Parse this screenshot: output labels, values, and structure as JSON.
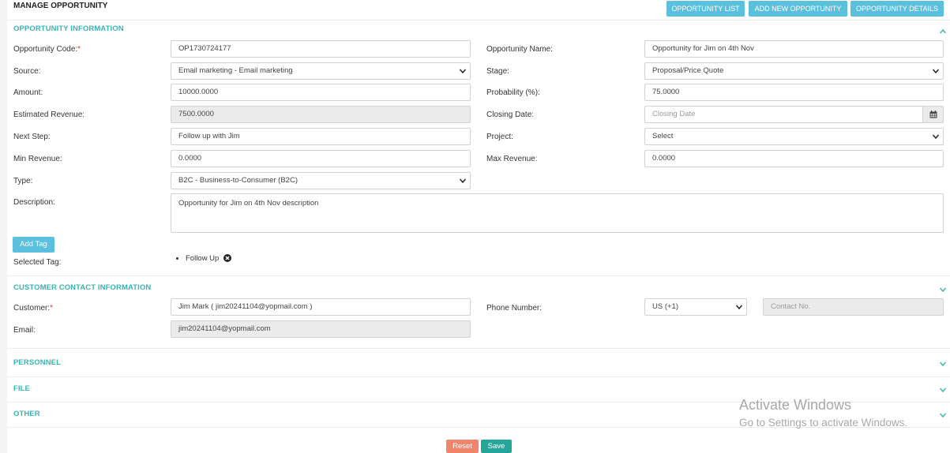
{
  "header": {
    "title": "MANAGE OPPORTUNITY",
    "buttons": {
      "list": "OPPORTUNITY LIST",
      "add_new": "ADD NEW OPPORTUNITY",
      "details": "OPPORTUNITY DETAILS"
    }
  },
  "opportunity_info": {
    "title": "OPPORTUNITY INFORMATION",
    "chevron": "chevron-up-icon",
    "fields": {
      "code": {
        "label": "Opportunity Code:",
        "required": "*",
        "value": "OP1730724177"
      },
      "name": {
        "label": "Opportunity Name:",
        "value": "Opportunity for Jim on 4th Nov"
      },
      "source": {
        "label": "Source:",
        "value": "Email marketing - Email marketing"
      },
      "stage": {
        "label": "Stage:",
        "value": "Proposal/Price Quote"
      },
      "amount": {
        "label": "Amount:",
        "value": "10000.0000"
      },
      "probability": {
        "label": "Probability (%):",
        "value": "75.0000"
      },
      "estimated_revenue": {
        "label": "Estimated Revenue:",
        "value": "7500.0000"
      },
      "closing_date": {
        "label": "Closing Date:",
        "value": "",
        "placeholder": "Closing Date"
      },
      "next_step": {
        "label": "Next Step:",
        "value": "Follow up with Jim"
      },
      "project": {
        "label": "Project:",
        "value": "Select"
      },
      "min_revenue": {
        "label": "Min Revenue:",
        "value": "0.0000"
      },
      "max_revenue": {
        "label": "Max Revenue:",
        "value": "0.0000"
      },
      "type": {
        "label": "Type:",
        "value": "B2C - Business-to-Consumer (B2C)"
      },
      "description": {
        "label": "Description:",
        "value": "Opportunity for Jim on 4th Nov description"
      }
    },
    "add_tag_label": "Add Tag",
    "selected_tag_label": "Selected Tag:",
    "tags": [
      "Follow Up"
    ]
  },
  "customer_contact": {
    "title": "CUSTOMER CONTACT INFORMATION",
    "chevron": "chevron-down-icon",
    "customer": {
      "label": "Customer:",
      "required": "*",
      "value": "Jim Mark ( jim20241104@yopmail.com )"
    },
    "phone": {
      "label": "Phone Number:",
      "country_code": "US (+1)",
      "placeholder": "Contact No."
    },
    "email": {
      "label": "Email:",
      "value": "jim20241104@yopmail.com"
    }
  },
  "sections": {
    "personnel": "PERSONNEL",
    "file": "FILE",
    "other": "OTHER"
  },
  "footer": {
    "reset": "Reset",
    "save": "Save"
  },
  "watermark": {
    "line1": "Activate Windows",
    "line2": "Go to Settings to activate Windows."
  },
  "colors": {
    "accent": "#5bc0de",
    "section_title": "#3bb4b0",
    "reset": "#f0856b",
    "save": "#26a69a",
    "required": "#e53935"
  }
}
